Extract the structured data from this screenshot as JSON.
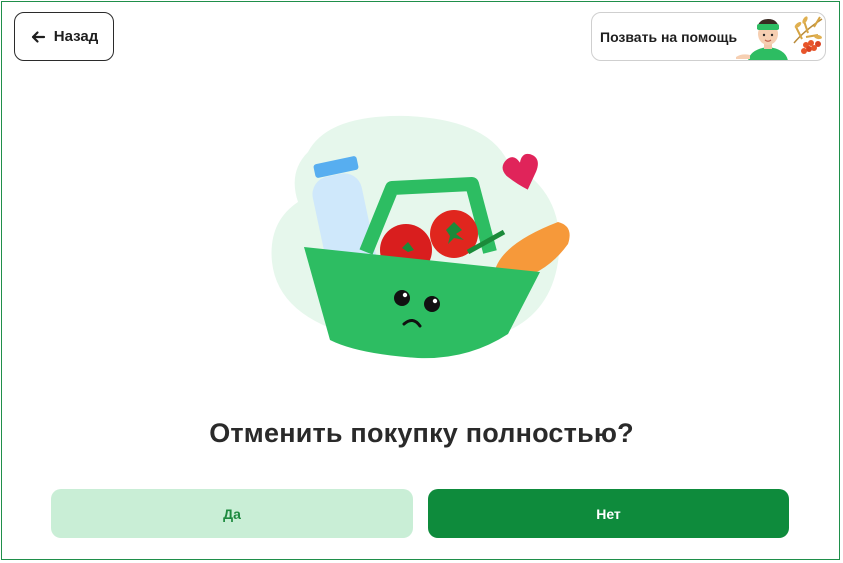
{
  "header": {
    "back_label": "Назад",
    "help_label": "Позвать на помощь"
  },
  "dialog": {
    "title": "Отменить покупку полностью?",
    "yes_label": "Да",
    "no_label": "Нет"
  },
  "icons": {
    "back": "arrow-left-icon",
    "help": "assistant-avatar-icon",
    "illustration": "sad-grocery-basket-illustration"
  },
  "colors": {
    "brand_green": "#0e8b3c",
    "light_green": "#c9eed6",
    "basket_green": "#2dbd62",
    "text_dark": "#2a2a2a"
  }
}
